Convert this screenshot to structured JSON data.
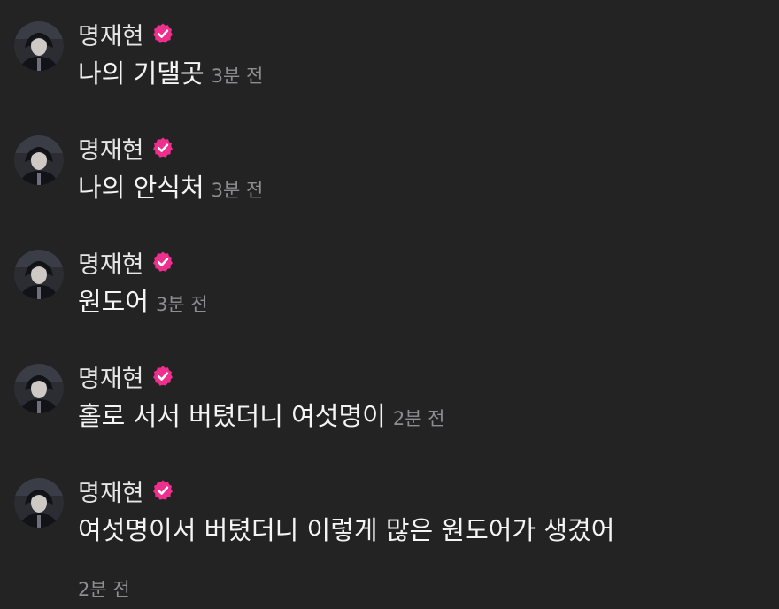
{
  "colors": {
    "background": "#232324",
    "badge": "#ee2f8e",
    "text": "#f4f4f4",
    "time": "#8e8e92"
  },
  "comments": [
    {
      "author": "명재현",
      "verified_icon": "verified-check-icon",
      "text": "나의 기댈곳",
      "time": "3분 전"
    },
    {
      "author": "명재현",
      "verified_icon": "verified-check-icon",
      "text": "나의 안식처",
      "time": "3분 전"
    },
    {
      "author": "명재현",
      "verified_icon": "verified-check-icon",
      "text": "원도어",
      "time": "3분 전"
    },
    {
      "author": "명재현",
      "verified_icon": "verified-check-icon",
      "text": "홀로 서서 버텼더니 여섯명이",
      "time": "2분 전"
    },
    {
      "author": "명재현",
      "verified_icon": "verified-check-icon",
      "text": "여섯명이서 버텼더니 이렇게 많은 원도어가 생겼어",
      "time": "2분 전"
    }
  ]
}
